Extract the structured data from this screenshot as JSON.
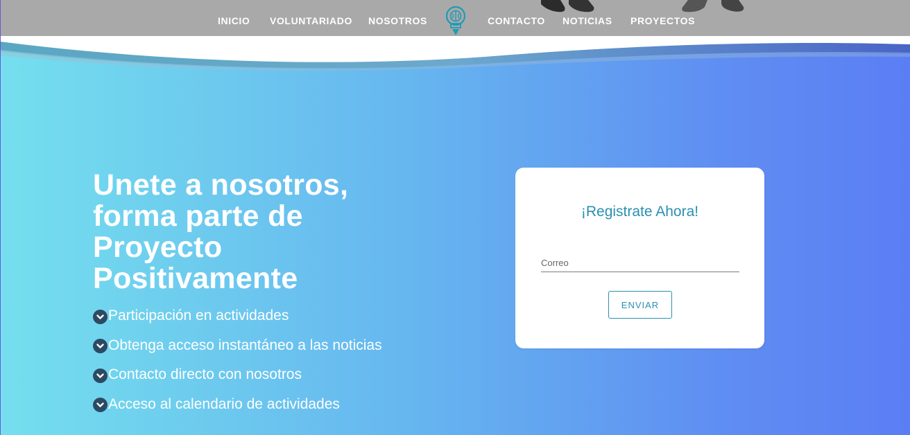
{
  "nav": {
    "items": [
      {
        "label": "INICIO"
      },
      {
        "label": "VOLUNTARIADO"
      },
      {
        "label": "NOSOTROS"
      },
      {
        "label": "CONTACTO"
      },
      {
        "label": "NOTICIAS"
      },
      {
        "label": "PROYECTOS"
      }
    ],
    "logo_icon": "lightbulb-brain-icon"
  },
  "hero": {
    "headline": "Unete a nosotros, forma parte de Proyecto Positivamente",
    "benefits": [
      {
        "icon": "chevron-down-circle-icon",
        "text": "Participación en actividades"
      },
      {
        "icon": "chevron-down-circle-icon",
        "text": "Obtenga acceso instantáneo a las noticias"
      },
      {
        "icon": "chevron-down-circle-icon",
        "text": "Contacto directo con nosotros"
      },
      {
        "icon": "chevron-down-circle-icon",
        "text": "Acceso al calendario de actividades"
      }
    ]
  },
  "signup": {
    "title": "¡Registrate Ahora!",
    "email_placeholder": "Correo",
    "email_value": "",
    "submit_label": "ENVIAR"
  },
  "colors": {
    "accent": "#2a8fb0",
    "gradient_start": "#74dfee",
    "gradient_end": "#5b7ef4",
    "header_bg": "#a9a9a9",
    "icon_bg": "#2d4a63"
  }
}
